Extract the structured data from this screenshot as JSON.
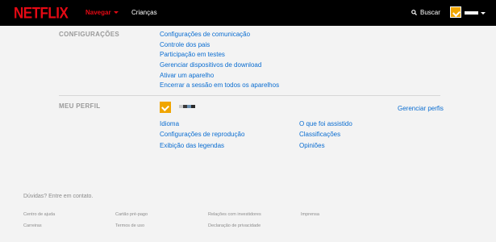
{
  "header": {
    "logo": "NETFLIX",
    "browse": "Navegar",
    "kids": "Crianças",
    "search": "Buscar"
  },
  "settings": {
    "title": "CONFIGURAÇÕES",
    "links": [
      "Configurações de comunicação",
      "Controle dos pais",
      "Participação em testes",
      "Gerenciar dispositivos de download",
      "Ativar um aparelho",
      "Encerrar a sessão em todos os aparelhos"
    ]
  },
  "profile": {
    "title": "MEU PERFIL",
    "manage": "Gerenciar perfis",
    "left_links": [
      "Idioma",
      "Configurações de reprodução",
      "Exibição das legendas"
    ],
    "right_links": [
      "O que foi assistido",
      "Classificações",
      "Opiniões"
    ]
  },
  "footer": {
    "question": "Dúvidas? Entre em contato.",
    "links": [
      "Centro de ajuda",
      "Cartão pré-pago",
      "Relações com investidores",
      "Imprensa",
      "Carreiras",
      "Termos de uso",
      "Declaração de privacidade"
    ]
  },
  "colors": {
    "brand": "#e50914",
    "link": "#0a6dd1",
    "header_bg": "#000000",
    "page_bg": "#f3f3f3"
  }
}
